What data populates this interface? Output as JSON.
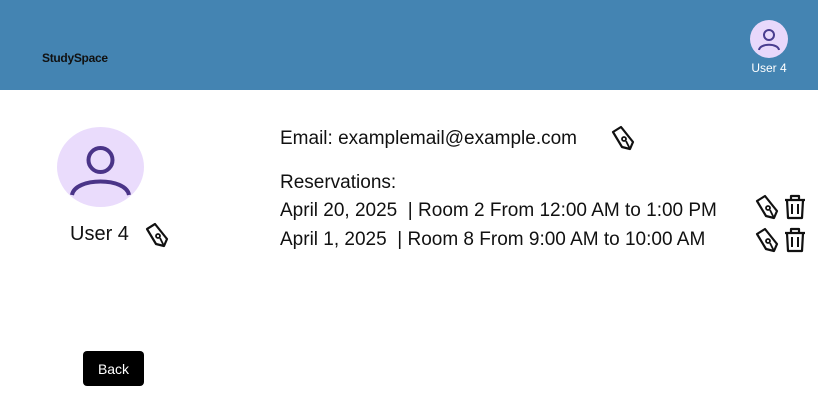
{
  "header": {
    "brand": "StudySpace",
    "user_name": "User 4",
    "avatar_icon": "user-icon",
    "avatar_bg": "#e8d8fb",
    "bar_color": "#4484b2"
  },
  "profile": {
    "name": "User 4",
    "avatar_icon": "user-icon",
    "edit_icon": "pen-icon"
  },
  "email": {
    "label": "Email:",
    "value": "examplemail@example.com",
    "edit_icon": "pen-icon"
  },
  "reservations": {
    "heading": "Reservations:",
    "items": [
      {
        "date": "April 20, 2025",
        "detail": "Room 2 From 12:00 AM to 1:00 PM",
        "edit_icon": "pen-icon",
        "delete_icon": "trash-icon"
      },
      {
        "date": "April 1, 2025",
        "detail": "Room 8 From 9:00 AM to 10:00 AM",
        "edit_icon": "pen-icon",
        "delete_icon": "trash-icon"
      }
    ]
  },
  "back_label": "Back"
}
